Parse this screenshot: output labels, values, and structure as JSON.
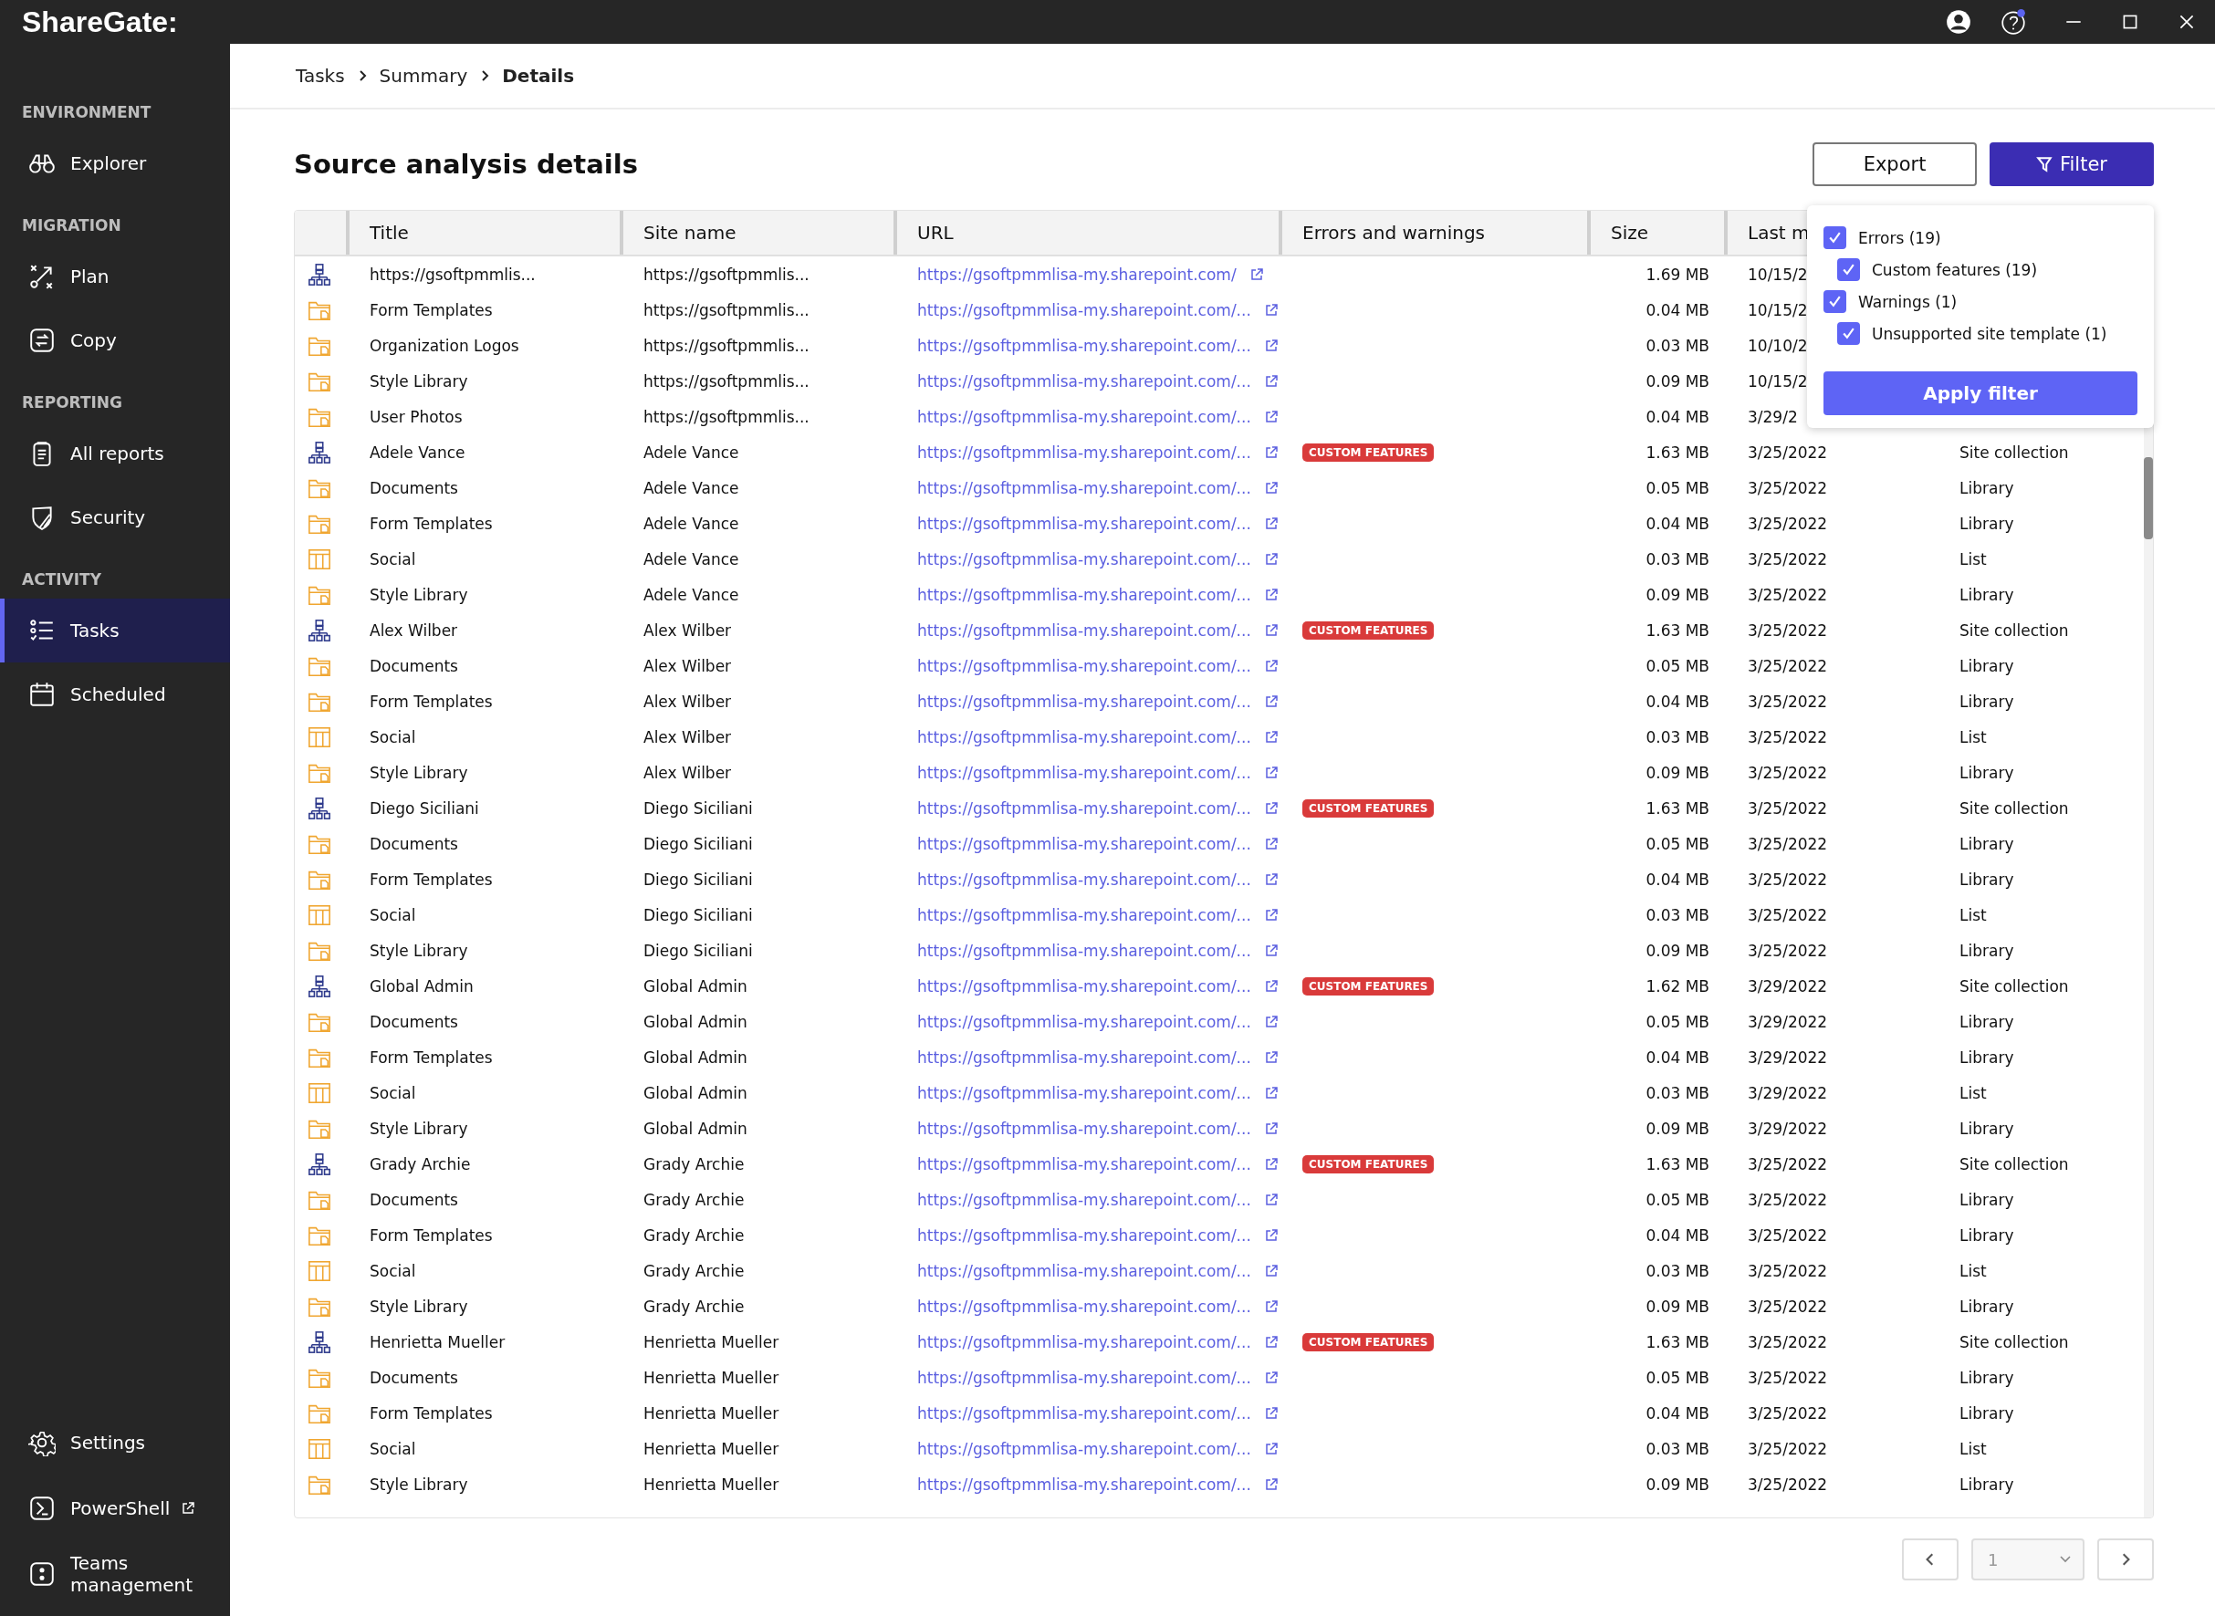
{
  "app": {
    "logo": "ShareGate:"
  },
  "sidebar": {
    "sections": [
      {
        "heading": "ENVIRONMENT",
        "items": [
          {
            "label": "Explorer",
            "selected": false
          }
        ]
      },
      {
        "heading": "MIGRATION",
        "items": [
          {
            "label": "Plan",
            "selected": false
          },
          {
            "label": "Copy",
            "selected": false
          }
        ]
      },
      {
        "heading": "REPORTING",
        "items": [
          {
            "label": "All reports",
            "selected": false
          },
          {
            "label": "Security",
            "selected": false
          }
        ]
      },
      {
        "heading": "ACTIVITY",
        "items": [
          {
            "label": "Tasks",
            "selected": true
          },
          {
            "label": "Scheduled",
            "selected": false
          }
        ]
      }
    ],
    "bottom_items": [
      {
        "label": "Settings"
      },
      {
        "label": "PowerShell"
      },
      {
        "label": "Teams management"
      }
    ]
  },
  "breadcrumb": [
    "Tasks",
    "Summary",
    "Details"
  ],
  "page_title": "Source analysis details",
  "actions": {
    "export": "Export",
    "filter": "Filter"
  },
  "filter_popup": {
    "options": [
      {
        "label": "Errors (19)",
        "checked": true,
        "children": [
          {
            "label": "Custom features (19)",
            "checked": true
          }
        ]
      },
      {
        "label": "Warnings (1)",
        "checked": true,
        "children": [
          {
            "label": "Unsupported site template (1)",
            "checked": true
          }
        ]
      }
    ],
    "apply": "Apply filter"
  },
  "table": {
    "columns": [
      "Title",
      "Site name",
      "URL",
      "Errors and warnings",
      "Size",
      "Last m"
    ],
    "rows": [
      {
        "kind": "site",
        "title": "https://gsoftpmmlis...",
        "site": "https://gsoftpmmlis...",
        "url": "https://gsoftpmmlisa-my.sharepoint.com/",
        "size": "1.69 MB",
        "modified": "10/15/2"
      },
      {
        "kind": "library",
        "title": "Form Templates",
        "site": "https://gsoftpmmlis...",
        "url": "https://gsoftpmmlisa-my.sharepoint.com/...",
        "size": "0.04 MB",
        "modified": "10/15/2"
      },
      {
        "kind": "library",
        "title": "Organization Logos",
        "site": "https://gsoftpmmlis...",
        "url": "https://gsoftpmmlisa-my.sharepoint.com/...",
        "size": "0.03 MB",
        "modified": "10/10/2"
      },
      {
        "kind": "library",
        "title": "Style Library",
        "site": "https://gsoftpmmlis...",
        "url": "https://gsoftpmmlisa-my.sharepoint.com/...",
        "size": "0.09 MB",
        "modified": "10/15/2"
      },
      {
        "kind": "library",
        "title": "User Photos",
        "site": "https://gsoftpmmlis...",
        "url": "https://gsoftpmmlisa-my.sharepoint.com/...",
        "size": "0.04 MB",
        "modified": "3/29/2"
      },
      {
        "kind": "site",
        "title": "Adele Vance",
        "site": "Adele Vance",
        "url": "https://gsoftpmmlisa-my.sharepoint.com/...",
        "badge": "CUSTOM FEATURES",
        "size": "1.63 MB",
        "modified": "3/25/2022",
        "type": "Site collection"
      },
      {
        "kind": "library",
        "title": "Documents",
        "site": "Adele Vance",
        "url": "https://gsoftpmmlisa-my.sharepoint.com/...",
        "size": "0.05 MB",
        "modified": "3/25/2022",
        "type": "Library"
      },
      {
        "kind": "library",
        "title": "Form Templates",
        "site": "Adele Vance",
        "url": "https://gsoftpmmlisa-my.sharepoint.com/...",
        "size": "0.04 MB",
        "modified": "3/25/2022",
        "type": "Library"
      },
      {
        "kind": "list",
        "title": "Social",
        "site": "Adele Vance",
        "url": "https://gsoftpmmlisa-my.sharepoint.com/...",
        "size": "0.03 MB",
        "modified": "3/25/2022",
        "type": "List"
      },
      {
        "kind": "library",
        "title": "Style Library",
        "site": "Adele Vance",
        "url": "https://gsoftpmmlisa-my.sharepoint.com/...",
        "size": "0.09 MB",
        "modified": "3/25/2022",
        "type": "Library"
      },
      {
        "kind": "site",
        "title": "Alex Wilber",
        "site": "Alex Wilber",
        "url": "https://gsoftpmmlisa-my.sharepoint.com/...",
        "badge": "CUSTOM FEATURES",
        "size": "1.63 MB",
        "modified": "3/25/2022",
        "type": "Site collection"
      },
      {
        "kind": "library",
        "title": "Documents",
        "site": "Alex Wilber",
        "url": "https://gsoftpmmlisa-my.sharepoint.com/...",
        "size": "0.05 MB",
        "modified": "3/25/2022",
        "type": "Library"
      },
      {
        "kind": "library",
        "title": "Form Templates",
        "site": "Alex Wilber",
        "url": "https://gsoftpmmlisa-my.sharepoint.com/...",
        "size": "0.04 MB",
        "modified": "3/25/2022",
        "type": "Library"
      },
      {
        "kind": "list",
        "title": "Social",
        "site": "Alex Wilber",
        "url": "https://gsoftpmmlisa-my.sharepoint.com/...",
        "size": "0.03 MB",
        "modified": "3/25/2022",
        "type": "List"
      },
      {
        "kind": "library",
        "title": "Style Library",
        "site": "Alex Wilber",
        "url": "https://gsoftpmmlisa-my.sharepoint.com/...",
        "size": "0.09 MB",
        "modified": "3/25/2022",
        "type": "Library"
      },
      {
        "kind": "site",
        "title": "Diego Siciliani",
        "site": "Diego Siciliani",
        "url": "https://gsoftpmmlisa-my.sharepoint.com/...",
        "badge": "CUSTOM FEATURES",
        "size": "1.63 MB",
        "modified": "3/25/2022",
        "type": "Site collection"
      },
      {
        "kind": "library",
        "title": "Documents",
        "site": "Diego Siciliani",
        "url": "https://gsoftpmmlisa-my.sharepoint.com/...",
        "size": "0.05 MB",
        "modified": "3/25/2022",
        "type": "Library"
      },
      {
        "kind": "library",
        "title": "Form Templates",
        "site": "Diego Siciliani",
        "url": "https://gsoftpmmlisa-my.sharepoint.com/...",
        "size": "0.04 MB",
        "modified": "3/25/2022",
        "type": "Library"
      },
      {
        "kind": "list",
        "title": "Social",
        "site": "Diego Siciliani",
        "url": "https://gsoftpmmlisa-my.sharepoint.com/...",
        "size": "0.03 MB",
        "modified": "3/25/2022",
        "type": "List"
      },
      {
        "kind": "library",
        "title": "Style Library",
        "site": "Diego Siciliani",
        "url": "https://gsoftpmmlisa-my.sharepoint.com/...",
        "size": "0.09 MB",
        "modified": "3/25/2022",
        "type": "Library"
      },
      {
        "kind": "site",
        "title": "Global Admin",
        "site": "Global Admin",
        "url": "https://gsoftpmmlisa-my.sharepoint.com/...",
        "badge": "CUSTOM FEATURES",
        "size": "1.62 MB",
        "modified": "3/29/2022",
        "type": "Site collection"
      },
      {
        "kind": "library",
        "title": "Documents",
        "site": "Global Admin",
        "url": "https://gsoftpmmlisa-my.sharepoint.com/...",
        "size": "0.05 MB",
        "modified": "3/29/2022",
        "type": "Library"
      },
      {
        "kind": "library",
        "title": "Form Templates",
        "site": "Global Admin",
        "url": "https://gsoftpmmlisa-my.sharepoint.com/...",
        "size": "0.04 MB",
        "modified": "3/29/2022",
        "type": "Library"
      },
      {
        "kind": "list",
        "title": "Social",
        "site": "Global Admin",
        "url": "https://gsoftpmmlisa-my.sharepoint.com/...",
        "size": "0.03 MB",
        "modified": "3/29/2022",
        "type": "List"
      },
      {
        "kind": "library",
        "title": "Style Library",
        "site": "Global Admin",
        "url": "https://gsoftpmmlisa-my.sharepoint.com/...",
        "size": "0.09 MB",
        "modified": "3/29/2022",
        "type": "Library"
      },
      {
        "kind": "site",
        "title": "Grady Archie",
        "site": "Grady Archie",
        "url": "https://gsoftpmmlisa-my.sharepoint.com/...",
        "badge": "CUSTOM FEATURES",
        "size": "1.63 MB",
        "modified": "3/25/2022",
        "type": "Site collection"
      },
      {
        "kind": "library",
        "title": "Documents",
        "site": "Grady Archie",
        "url": "https://gsoftpmmlisa-my.sharepoint.com/...",
        "size": "0.05 MB",
        "modified": "3/25/2022",
        "type": "Library"
      },
      {
        "kind": "library",
        "title": "Form Templates",
        "site": "Grady Archie",
        "url": "https://gsoftpmmlisa-my.sharepoint.com/...",
        "size": "0.04 MB",
        "modified": "3/25/2022",
        "type": "Library"
      },
      {
        "kind": "list",
        "title": "Social",
        "site": "Grady Archie",
        "url": "https://gsoftpmmlisa-my.sharepoint.com/...",
        "size": "0.03 MB",
        "modified": "3/25/2022",
        "type": "List"
      },
      {
        "kind": "library",
        "title": "Style Library",
        "site": "Grady Archie",
        "url": "https://gsoftpmmlisa-my.sharepoint.com/...",
        "size": "0.09 MB",
        "modified": "3/25/2022",
        "type": "Library"
      },
      {
        "kind": "site",
        "title": "Henrietta Mueller",
        "site": "Henrietta Mueller",
        "url": "https://gsoftpmmlisa-my.sharepoint.com/...",
        "badge": "CUSTOM FEATURES",
        "size": "1.63 MB",
        "modified": "3/25/2022",
        "type": "Site collection"
      },
      {
        "kind": "library",
        "title": "Documents",
        "site": "Henrietta Mueller",
        "url": "https://gsoftpmmlisa-my.sharepoint.com/...",
        "size": "0.05 MB",
        "modified": "3/25/2022",
        "type": "Library"
      },
      {
        "kind": "library",
        "title": "Form Templates",
        "site": "Henrietta Mueller",
        "url": "https://gsoftpmmlisa-my.sharepoint.com/...",
        "size": "0.04 MB",
        "modified": "3/25/2022",
        "type": "Library"
      },
      {
        "kind": "list",
        "title": "Social",
        "site": "Henrietta Mueller",
        "url": "https://gsoftpmmlisa-my.sharepoint.com/...",
        "size": "0.03 MB",
        "modified": "3/25/2022",
        "type": "List"
      },
      {
        "kind": "library",
        "title": "Style Library",
        "site": "Henrietta Mueller",
        "url": "https://gsoftpmmlisa-my.sharepoint.com/...",
        "size": "0.09 MB",
        "modified": "3/25/2022",
        "type": "Library"
      }
    ]
  },
  "pagination": {
    "page": "1"
  }
}
